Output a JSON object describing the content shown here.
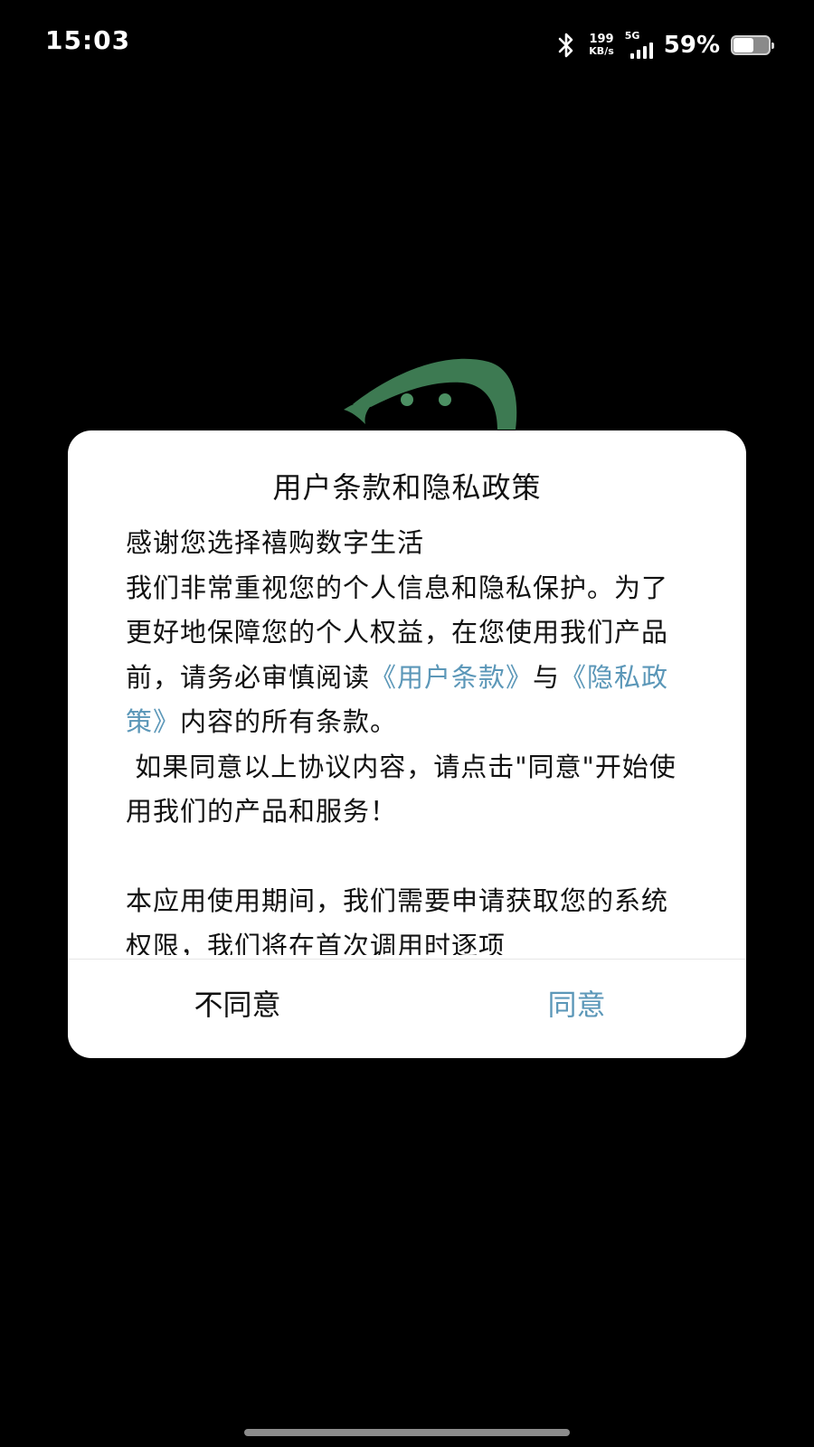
{
  "status_bar": {
    "time": "15:03",
    "net_speed_value": "199",
    "net_speed_unit": "KB/s",
    "network_type": "5G",
    "battery_percent_text": "59%",
    "battery_level": 0.59,
    "icons": [
      "bluetooth-icon",
      "signal-icon",
      "battery-icon"
    ]
  },
  "background_logo": {
    "icon": "app-logo-icon",
    "color": "#3d7a52"
  },
  "dialog": {
    "title": "用户条款和隐私政策",
    "paragraph1": {
      "line1": "感谢您选择禧购数字生活",
      "line2": "我们非常重视您的个人信息和隐私保护。为了更好地保障您的个人权益，在您使用我们产品前，请务必审慎阅读",
      "link_terms": "《用户条款》",
      "and": "与",
      "link_privacy": "《隐私政策》",
      "tail": "内容的所有条款。",
      "line3": " 如果同意以上协议内容，请点击\"同意\"开始使用我们的产品和服务！"
    },
    "paragraph2": "本应用使用期间，我们需要申请获取您的系统权限，我们将在首次调用时逐项",
    "buttons": {
      "disagree": "不同意",
      "agree": "同意"
    },
    "colors": {
      "link": "#5b97b8",
      "agree": "#5b97b8"
    }
  }
}
